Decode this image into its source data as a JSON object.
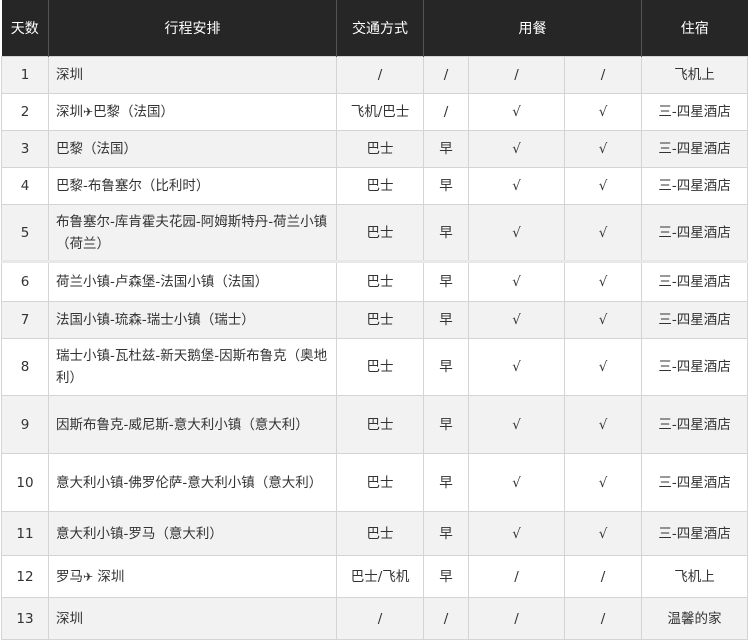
{
  "headers": {
    "day": "天数",
    "route": "行程安排",
    "transport": "交通方式",
    "meals": "用餐",
    "hotel": "住宿"
  },
  "rows": [
    {
      "day": "1",
      "route": "深圳",
      "transport": "/",
      "m1": "/",
      "m2": "/",
      "m3": "/",
      "hotel": "飞机上"
    },
    {
      "day": "2",
      "route_a": "深圳",
      "plane": "✈",
      "route_b": "巴黎（法国）",
      "transport": "飞机/巴士",
      "m1": "/",
      "m2": "√",
      "m3": "√",
      "hotel": "三-四星酒店"
    },
    {
      "day": "3",
      "route": "巴黎（法国）",
      "transport": "巴士",
      "m1": "早",
      "m2": "√",
      "m3": "√",
      "hotel": "三-四星酒店"
    },
    {
      "day": "4",
      "route": "巴黎-布鲁塞尔（比利时）",
      "transport": "巴士",
      "m1": "早",
      "m2": "√",
      "m3": "√",
      "hotel": "三-四星酒店"
    },
    {
      "day": "5",
      "route": "布鲁塞尔-库肯霍夫花园-阿姆斯特丹-荷兰小镇（荷兰）",
      "transport": "巴士",
      "m1": "早",
      "m2": "√",
      "m3": "√",
      "hotel": "三-四星酒店"
    },
    {
      "day": "6",
      "route": "荷兰小镇-卢森堡-法国小镇（法国）",
      "transport": "巴士",
      "m1": "早",
      "m2": "√",
      "m3": "√",
      "hotel": "三-四星酒店"
    },
    {
      "day": "7",
      "route": "法国小镇-琉森-瑞士小镇（瑞士）",
      "transport": "巴士",
      "m1": "早",
      "m2": "√",
      "m3": "√",
      "hotel": "三-四星酒店"
    },
    {
      "day": "8",
      "route": "瑞士小镇-瓦杜兹-新天鹅堡-因斯布鲁克（奥地利）",
      "transport": "巴士",
      "m1": "早",
      "m2": "√",
      "m3": "√",
      "hotel": "三-四星酒店"
    },
    {
      "day": "9",
      "route": "因斯布鲁克-威尼斯-意大利小镇（意大利）",
      "transport": "巴士",
      "m1": "早",
      "m2": "√",
      "m3": "√",
      "hotel": "三-四星酒店"
    },
    {
      "day": "10",
      "route": "意大利小镇-佛罗伦萨-意大利小镇（意大利）",
      "transport": "巴士",
      "m1": "早",
      "m2": "√",
      "m3": "√",
      "hotel": "三-四星酒店"
    },
    {
      "day": "11",
      "route": "意大利小镇-罗马（意大利）",
      "transport": "巴士",
      "m1": "早",
      "m2": "√",
      "m3": "√",
      "hotel": "三-四星酒店"
    },
    {
      "day": "12",
      "route_a": "罗马",
      "plane": "✈",
      "route_b": " 深圳",
      "transport": "巴士/飞机",
      "m1": "早",
      "m2": "/",
      "m3": "/",
      "hotel": "飞机上"
    },
    {
      "day": "13",
      "route": "深圳",
      "transport": "/",
      "m1": "/",
      "m2": "/",
      "m3": "/",
      "hotel": "温馨的家"
    }
  ]
}
